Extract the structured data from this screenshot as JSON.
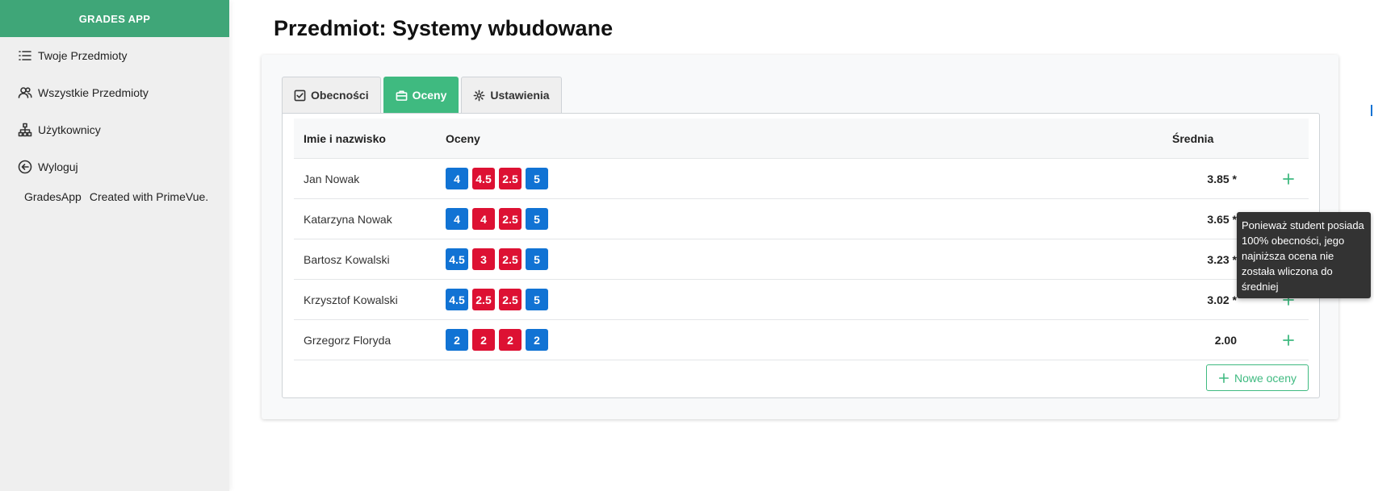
{
  "app": {
    "brand": "GRADES APP"
  },
  "sidebar": {
    "items": [
      {
        "label": "Twoje Przedmioty",
        "icon": "list-icon"
      },
      {
        "label": "Wszystkie Przedmioty",
        "icon": "users-icon"
      },
      {
        "label": "Użytkownicy",
        "icon": "sitemap-icon"
      },
      {
        "label": "Wyloguj",
        "icon": "arrow-circle-left-icon"
      }
    ],
    "footer_app": "GradesApp",
    "footer_credit": "Created with PrimeVue."
  },
  "page": {
    "title": "Przedmiot: Systemy wbudowane"
  },
  "tabs": [
    {
      "label": "Obecności",
      "icon": "check-square-icon",
      "active": false
    },
    {
      "label": "Oceny",
      "icon": "briefcase-icon",
      "active": true
    },
    {
      "label": "Ustawienia",
      "icon": "cog-icon",
      "active": false
    }
  ],
  "table": {
    "headers": {
      "name": "Imie i nazwisko",
      "grades": "Oceny",
      "average": "Średnia"
    },
    "rows": [
      {
        "name": "Jan Nowak",
        "grades": [
          "4",
          "4.5",
          "2.5",
          "5"
        ],
        "average": "3.85 *"
      },
      {
        "name": "Katarzyna Nowak",
        "grades": [
          "4",
          "4",
          "2.5",
          "5"
        ],
        "average": "3.65 *"
      },
      {
        "name": "Bartosz Kowalski",
        "grades": [
          "4.5",
          "3",
          "2.5",
          "5"
        ],
        "average": "3.23 *"
      },
      {
        "name": "Krzysztof Kowalski",
        "grades": [
          "4.5",
          "2.5",
          "2.5",
          "5"
        ],
        "average": "3.02 *"
      },
      {
        "name": "Grzegorz Floryda",
        "grades": [
          "2",
          "2",
          "2",
          "2"
        ],
        "average": "2.00"
      }
    ],
    "grade_colors": {
      "row0": [
        "blue",
        "red",
        "red",
        "blue"
      ],
      "row1": [
        "blue",
        "red",
        "red",
        "blue"
      ],
      "row2": [
        "blue",
        "red",
        "red",
        "blue"
      ],
      "row3": [
        "blue",
        "red",
        "red",
        "blue"
      ],
      "row4": [
        "blue",
        "red",
        "red",
        "blue"
      ]
    }
  },
  "actions": {
    "new_grades": "Nowe oceny"
  },
  "tooltip": {
    "text": "Ponieważ student posiada 100% obecności, jego najniższa ocena nie została wliczona do średniej"
  },
  "colors": {
    "accent": "#3fba80",
    "brand": "#3fa678",
    "grade_blue": "#1173d4",
    "grade_red": "#dd1133"
  }
}
